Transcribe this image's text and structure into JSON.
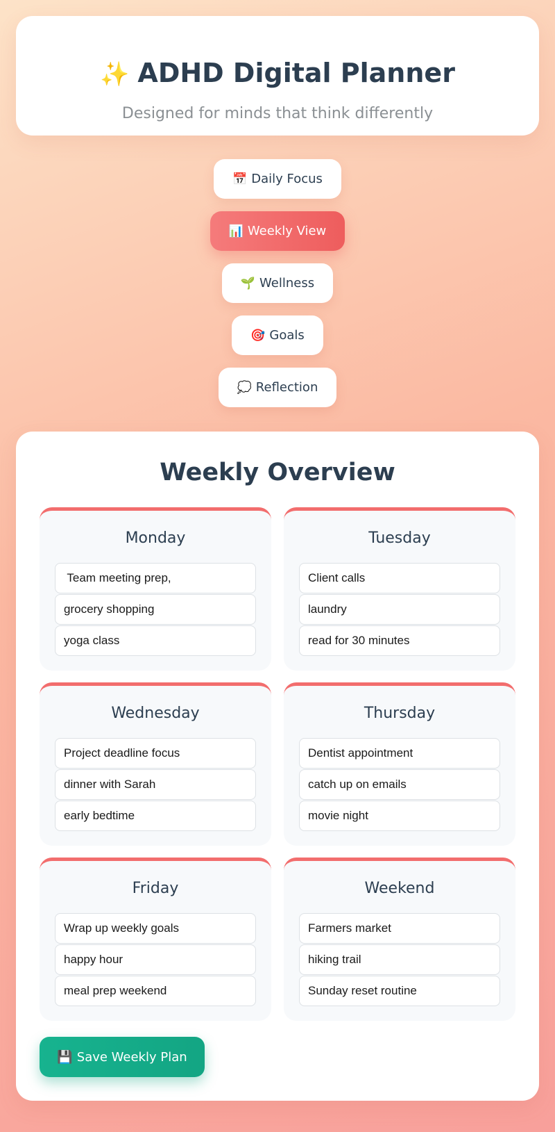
{
  "header": {
    "title_icon": "✨",
    "title": "ADHD Digital Planner",
    "subtitle": "Designed for minds that think differently"
  },
  "nav": {
    "items": [
      {
        "icon": "📅",
        "label": "Daily Focus",
        "active": false
      },
      {
        "icon": "📊",
        "label": "Weekly View",
        "active": true
      },
      {
        "icon": "🌱",
        "label": "Wellness",
        "active": false
      },
      {
        "icon": "🎯",
        "label": "Goals",
        "active": false
      },
      {
        "icon": "💭",
        "label": "Reflection",
        "active": false
      }
    ]
  },
  "weekly": {
    "title": "Weekly Overview",
    "days": [
      {
        "name": "Monday",
        "tasks": [
          " Team meeting prep,",
          "grocery shopping",
          "yoga class"
        ]
      },
      {
        "name": "Tuesday",
        "tasks": [
          "Client calls",
          "laundry",
          "read for 30 minutes"
        ]
      },
      {
        "name": "Wednesday",
        "tasks": [
          "Project deadline focus",
          "dinner with Sarah",
          "early bedtime"
        ]
      },
      {
        "name": "Thursday",
        "tasks": [
          "Dentist appointment",
          "catch up on emails",
          "movie night"
        ]
      },
      {
        "name": "Friday",
        "tasks": [
          "Wrap up weekly goals",
          "happy hour",
          "meal prep weekend"
        ]
      },
      {
        "name": "Weekend",
        "tasks": [
          "Farmers market",
          "hiking trail",
          "Sunday reset routine"
        ]
      }
    ],
    "save_icon": "💾",
    "save_label": "Save Weekly Plan"
  },
  "colors": {
    "accent": "#f26d6d",
    "active_nav": "#ee5d5d",
    "save": "#13a583",
    "text": "#2c3e50"
  }
}
